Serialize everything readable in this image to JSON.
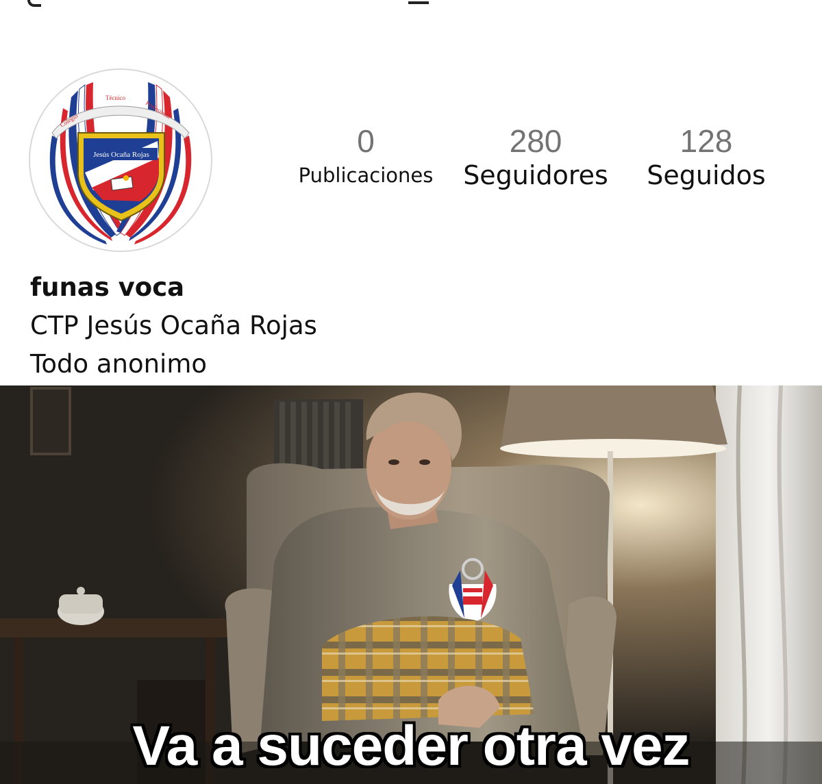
{
  "profile": {
    "username": "funas voca",
    "bio_lines": [
      "CTP Jesús Ocaña Rojas",
      "Todo anonimo"
    ],
    "avatar": {
      "arc_text": [
        "Colegio",
        "Técnico",
        "Profesional"
      ],
      "shield_text": "Jesús Ocaña Rojas",
      "flag_colors": {
        "blue": "#1f3f94",
        "red": "#d8262f",
        "white": "#ffffff"
      }
    },
    "stats": [
      {
        "value": "0",
        "label": "Publicaciones"
      },
      {
        "value": "280",
        "label": "Seguidores"
      },
      {
        "value": "128",
        "label": "Seguidos"
      }
    ]
  },
  "meme": {
    "caption": "Va a suceder otra vez"
  }
}
